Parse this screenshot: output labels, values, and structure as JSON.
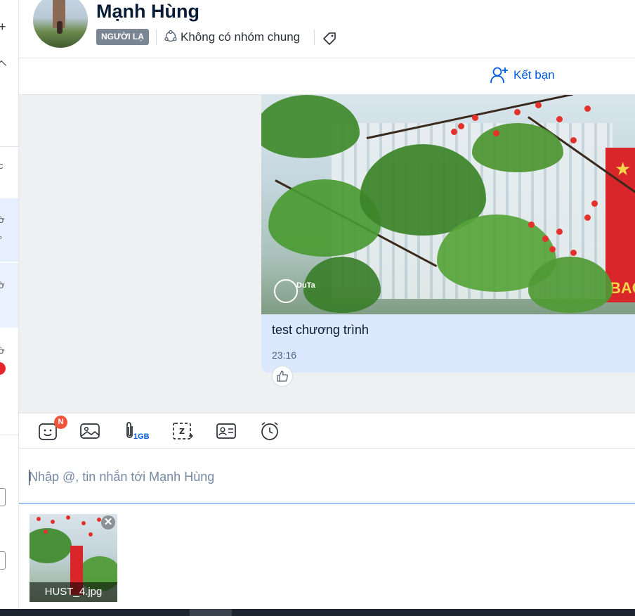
{
  "contact": {
    "name": "Mạnh Hùng",
    "status_badge": "NGƯỜI LẠ",
    "common_groups": "Không có nhóm chung"
  },
  "friend_action": {
    "label": "Kết bạn"
  },
  "message": {
    "text": "test chương trình",
    "time": "23:16"
  },
  "toolbar": {
    "sticker_badge": "N",
    "file_limit": "1GB"
  },
  "composer": {
    "placeholder": "Nhập @, tin nhắn tới Mạnh Hùng"
  },
  "attachment": {
    "filename": "HUST_4.jpg"
  },
  "colors": {
    "accent": "#005ae0",
    "message_bubble": "#dbe8fd",
    "chat_background": "#eef0f1",
    "badge_gray": "#7b8694",
    "notification": "#f0553c"
  }
}
